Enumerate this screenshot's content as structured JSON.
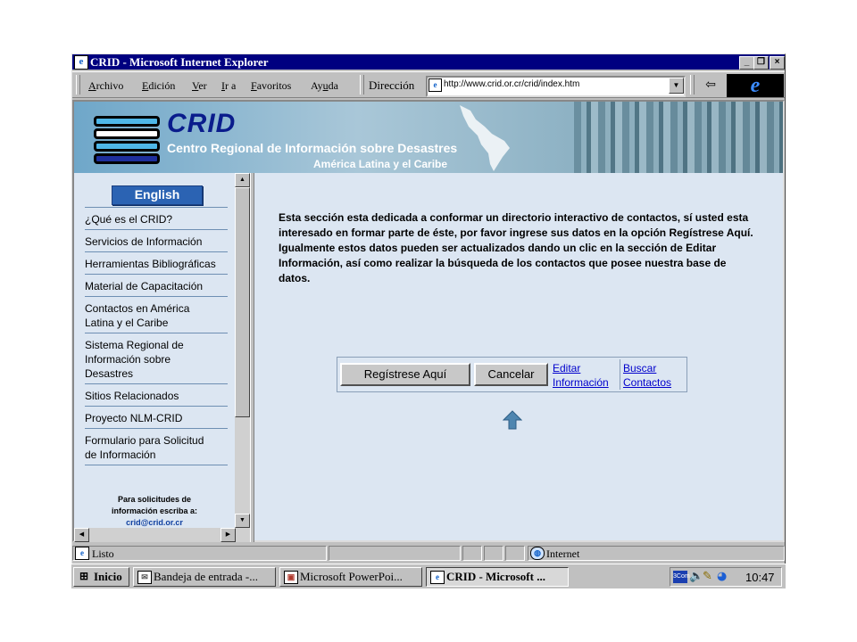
{
  "window": {
    "title": "CRID - Microsoft Internet Explorer",
    "min_btn": "_",
    "max_btn": "❐",
    "close_btn": "×"
  },
  "menubar": {
    "items": [
      {
        "pre": "",
        "u": "A",
        "post": "rchivo"
      },
      {
        "pre": "",
        "u": "E",
        "post": "dición"
      },
      {
        "pre": "",
        "u": "V",
        "post": "er"
      },
      {
        "pre": "",
        "u": "I",
        "post": "r a"
      },
      {
        "pre": "",
        "u": "F",
        "post": "avoritos"
      },
      {
        "pre": "Ay",
        "u": "u",
        "post": "da"
      }
    ],
    "address_label": "Dirección",
    "address_url": "http://www.crid.or.cr/crid/index.htm"
  },
  "banner": {
    "logo": "CRID",
    "subtitle": "Centro Regional de Información sobre Desastres",
    "region": "América Latina  y el Caribe"
  },
  "sidebar": {
    "english_button": "English",
    "items": [
      "¿Qué es el CRID?",
      "Servicios de Información",
      "Herramientas Bibliográficas",
      "Material de Capacitación",
      "Contactos en América Latina y el Caribe",
      "Sistema Regional de Información sobre Desastres",
      "Sitios Relacionados",
      "Proyecto NLM-CRID",
      "Formulario para Solicitud de Información"
    ],
    "note_line1": "Para solicitudes de",
    "note_line2": "información escriba a:",
    "note_email": "crid@crid.or.cr"
  },
  "main": {
    "paragraph": "Esta sección esta dedicada a conformar un directorio interactivo de contactos, sí usted esta interesado en formar parte de éste, por favor ingrese sus datos en la opción Regístrese Aquí. Igualmente estos datos pueden ser actualizados dando un clic en la sección de Editar Información, así como realizar la búsqueda de los contactos que posee nuestra base de datos.",
    "register_button": "Regístrese Aquí",
    "cancel_button": "Cancelar",
    "edit_link_1": "Editar",
    "edit_link_2": "Información",
    "search_link_1": "Buscar",
    "search_link_2": "Contactos"
  },
  "statusbar": {
    "status": "Listo",
    "zone": "Internet"
  },
  "taskbar": {
    "start": "Inicio",
    "tasks": [
      "Bandeja de entrada -...",
      "Microsoft PowerPoi...",
      "CRID - Microsoft ..."
    ],
    "clock": "10:47"
  }
}
